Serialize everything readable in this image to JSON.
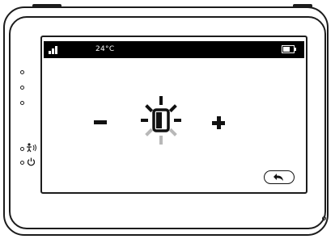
{
  "status_bar": {
    "temperature": "24°C",
    "signal_icon": "signal-bars-icon",
    "battery_icon": "battery-icon"
  },
  "brightness_control": {
    "decrease_icon": "minus-icon",
    "increase_icon": "plus-icon",
    "level_icon": "brightness-icon",
    "level": 0.625
  },
  "back_button": {
    "icon": "back-arrow-icon"
  },
  "side_indicators": {
    "sound_icon": "sound-activation-icon",
    "power_icon": "power-icon"
  },
  "colors": {
    "bezel": "#1c1c1c",
    "status_bar_bg": "#000000",
    "active_ray": "#111111",
    "inactive_ray": "#b8b8b8"
  }
}
